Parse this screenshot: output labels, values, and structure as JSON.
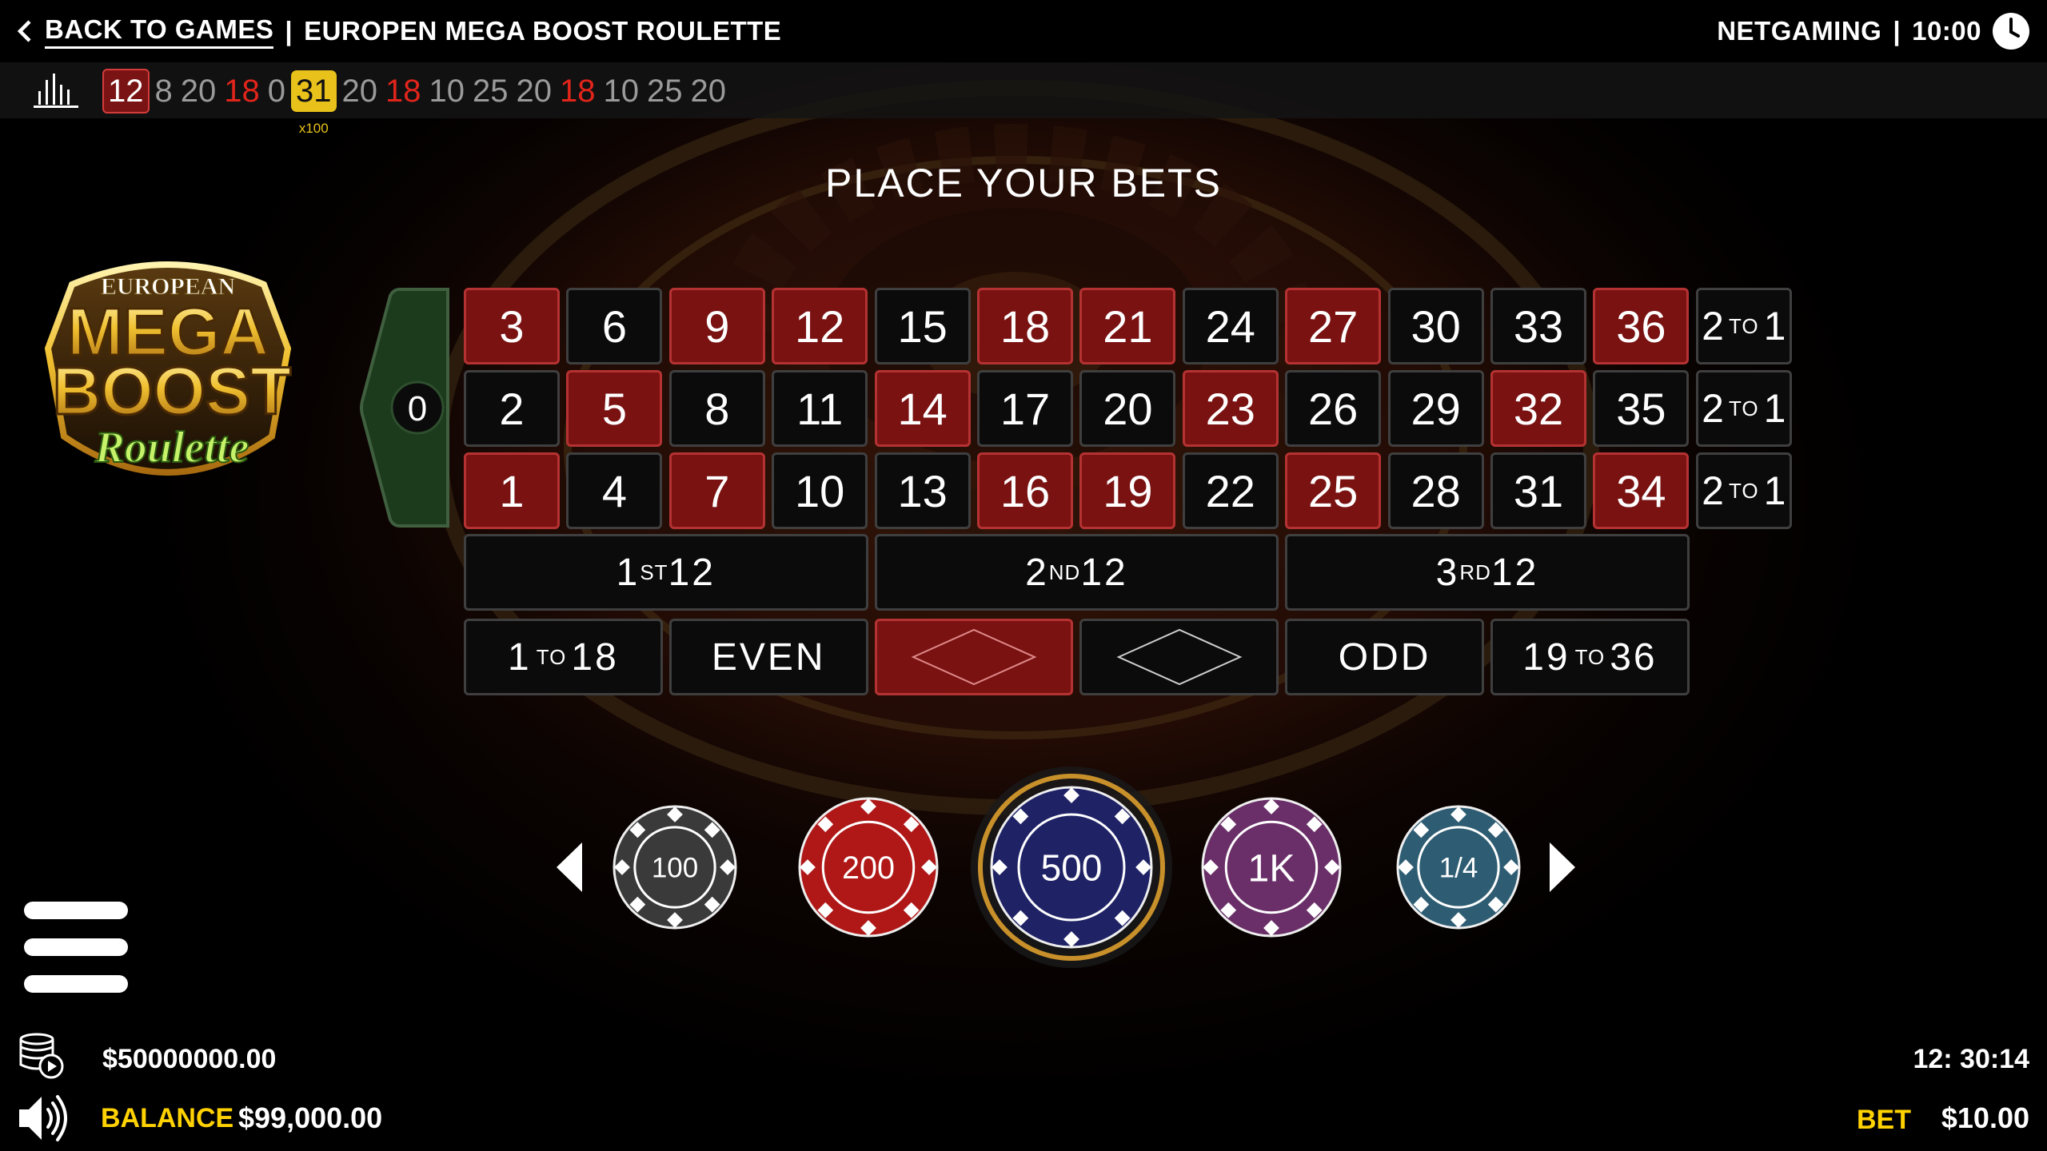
{
  "header": {
    "back_label": "BACK TO GAMES",
    "separator": "|",
    "game_title": "EUROPEN MEGA BOOST ROULETTE",
    "provider": "NETGAMING",
    "time": "10:00"
  },
  "history": {
    "numbers": [
      {
        "value": "12",
        "color": "red",
        "latest": true
      },
      {
        "value": "8",
        "color": "black"
      },
      {
        "value": "20",
        "color": "black"
      },
      {
        "value": "18",
        "color": "red"
      },
      {
        "value": "0",
        "color": "green"
      },
      {
        "value": "31",
        "color": "black",
        "multiplier": "x100"
      },
      {
        "value": "20",
        "color": "black"
      },
      {
        "value": "18",
        "color": "red"
      },
      {
        "value": "10",
        "color": "black"
      },
      {
        "value": "25",
        "color": "black"
      },
      {
        "value": "20",
        "color": "black"
      },
      {
        "value": "18",
        "color": "red"
      },
      {
        "value": "10",
        "color": "black"
      },
      {
        "value": "25",
        "color": "black"
      },
      {
        "value": "20",
        "color": "black"
      }
    ]
  },
  "prompt": "PLACE YOUR BETS",
  "logo": {
    "line1": "EUROPEAN",
    "line2": "MEGA",
    "line3": "BOOST",
    "line4": "Roulette"
  },
  "table": {
    "zero": "0",
    "rows": [
      [
        {
          "n": "3",
          "c": "red"
        },
        {
          "n": "6",
          "c": "black"
        },
        {
          "n": "9",
          "c": "red"
        },
        {
          "n": "12",
          "c": "red"
        },
        {
          "n": "15",
          "c": "black"
        },
        {
          "n": "18",
          "c": "red"
        },
        {
          "n": "21",
          "c": "red"
        },
        {
          "n": "24",
          "c": "black"
        },
        {
          "n": "27",
          "c": "red"
        },
        {
          "n": "30",
          "c": "black"
        },
        {
          "n": "33",
          "c": "black"
        },
        {
          "n": "36",
          "c": "red"
        }
      ],
      [
        {
          "n": "2",
          "c": "black"
        },
        {
          "n": "5",
          "c": "red"
        },
        {
          "n": "8",
          "c": "black"
        },
        {
          "n": "11",
          "c": "black"
        },
        {
          "n": "14",
          "c": "red"
        },
        {
          "n": "17",
          "c": "black"
        },
        {
          "n": "20",
          "c": "black"
        },
        {
          "n": "23",
          "c": "red"
        },
        {
          "n": "26",
          "c": "black"
        },
        {
          "n": "29",
          "c": "black"
        },
        {
          "n": "32",
          "c": "red"
        },
        {
          "n": "35",
          "c": "black"
        }
      ],
      [
        {
          "n": "1",
          "c": "red"
        },
        {
          "n": "4",
          "c": "black"
        },
        {
          "n": "7",
          "c": "red"
        },
        {
          "n": "10",
          "c": "black"
        },
        {
          "n": "13",
          "c": "black"
        },
        {
          "n": "16",
          "c": "red"
        },
        {
          "n": "19",
          "c": "red"
        },
        {
          "n": "22",
          "c": "black"
        },
        {
          "n": "25",
          "c": "red"
        },
        {
          "n": "28",
          "c": "black"
        },
        {
          "n": "31",
          "c": "black"
        },
        {
          "n": "34",
          "c": "red"
        }
      ]
    ],
    "column_bet": {
      "left": "2",
      "small": "TO",
      "right": "1"
    },
    "dozens": [
      {
        "num": "1",
        "sup": "ST",
        "tail": "12"
      },
      {
        "num": "2",
        "sup": "ND",
        "tail": "12"
      },
      {
        "num": "3",
        "sup": "RD",
        "tail": "12"
      }
    ],
    "low": {
      "left": "1",
      "small": "TO",
      "right": "18"
    },
    "even": "EVEN",
    "odd": "ODD",
    "high": {
      "left": "19",
      "small": "TO",
      "right": "36"
    }
  },
  "chips": [
    {
      "label": "100",
      "color": "#3a3a3a",
      "selected": false
    },
    {
      "label": "200",
      "color": "#b01818",
      "selected": false
    },
    {
      "label": "500",
      "color": "#1f2366",
      "selected": true
    },
    {
      "label": "1K",
      "color": "#6a2f68",
      "selected": false
    },
    {
      "label": "1/4",
      "color": "#2e5d73",
      "selected": false
    }
  ],
  "footer": {
    "total_amount": "$50000000.00",
    "balance_label": "BALANCE",
    "balance_value": "$99,000.00",
    "clock": "12: 30:14",
    "bet_label": "BET",
    "bet_value": "$10.00"
  },
  "colors": {
    "red_cell": "#7a1212",
    "black_cell": "#0b0b0b",
    "zero_green": "#1c3a1c",
    "accent_yellow": "#ffd200",
    "selected_chip_ring": "#c8902a"
  }
}
